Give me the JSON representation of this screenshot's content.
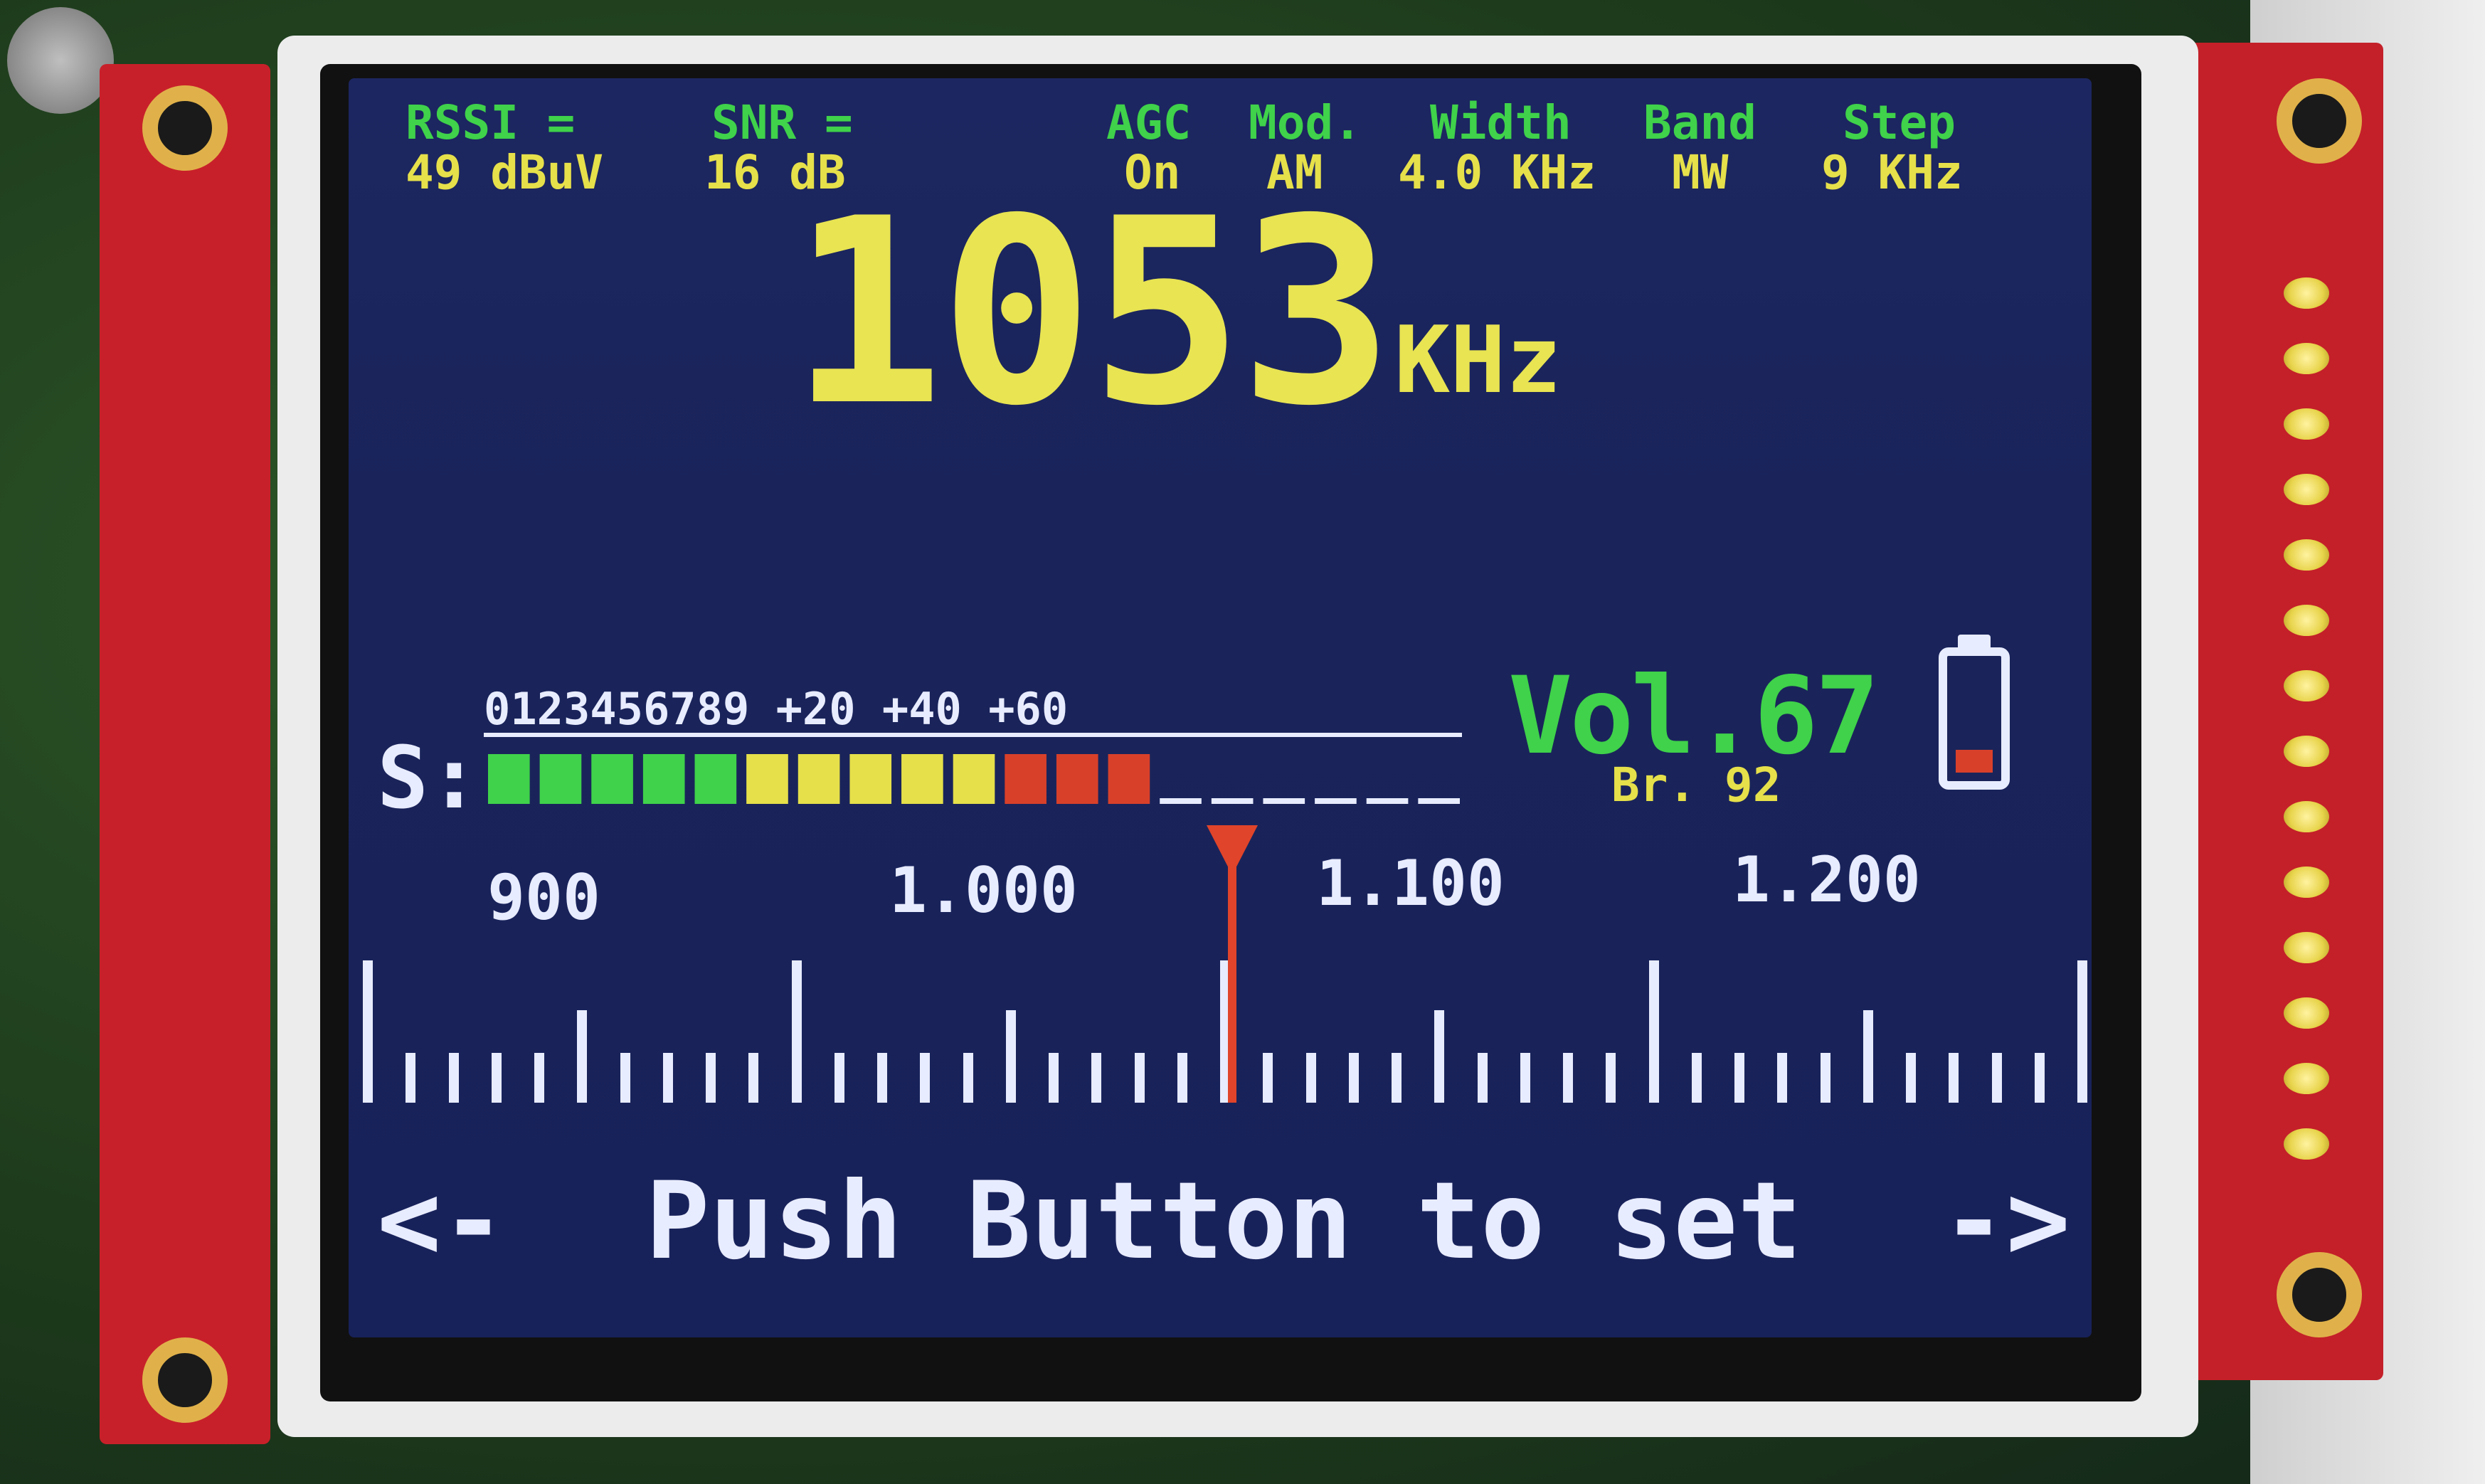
{
  "status": {
    "rssi_label": "RSSI =",
    "rssi_value": "49 dBuV",
    "snr_label": "SNR =",
    "snr_value": "16 dB",
    "agc_label": "AGC",
    "agc_value": "On",
    "mod_label": "Mod.",
    "mod_value": "AM",
    "width_label": "Width",
    "width_value": "4.0 KHz",
    "band_label": "Band",
    "band_value": "MW",
    "step_label": "Step",
    "step_value": "9 KHz"
  },
  "frequency": {
    "value": "1053",
    "unit": "KHz"
  },
  "smeter": {
    "label": "S:",
    "scale": "0123456789 +20 +40 +60",
    "segments_total": 19,
    "segments_lit": 13,
    "colors": {
      "green": "#3fd24a",
      "yellow": "#e6e04a",
      "red": "#d8402a",
      "off": "#e8ecff"
    }
  },
  "volume": {
    "label": "Vol.",
    "value": "67",
    "brightness_label": "Br.",
    "brightness_value": "92"
  },
  "battery": {
    "level_fraction": 0.18,
    "color": "#d8402a"
  },
  "dial": {
    "labels": [
      "900",
      "1.000",
      "1.100",
      "1.200"
    ],
    "pointer_color": "#e0442a"
  },
  "footer": {
    "left_arrow": "<-",
    "message": "Push Button to set",
    "right_arrow": "->"
  }
}
